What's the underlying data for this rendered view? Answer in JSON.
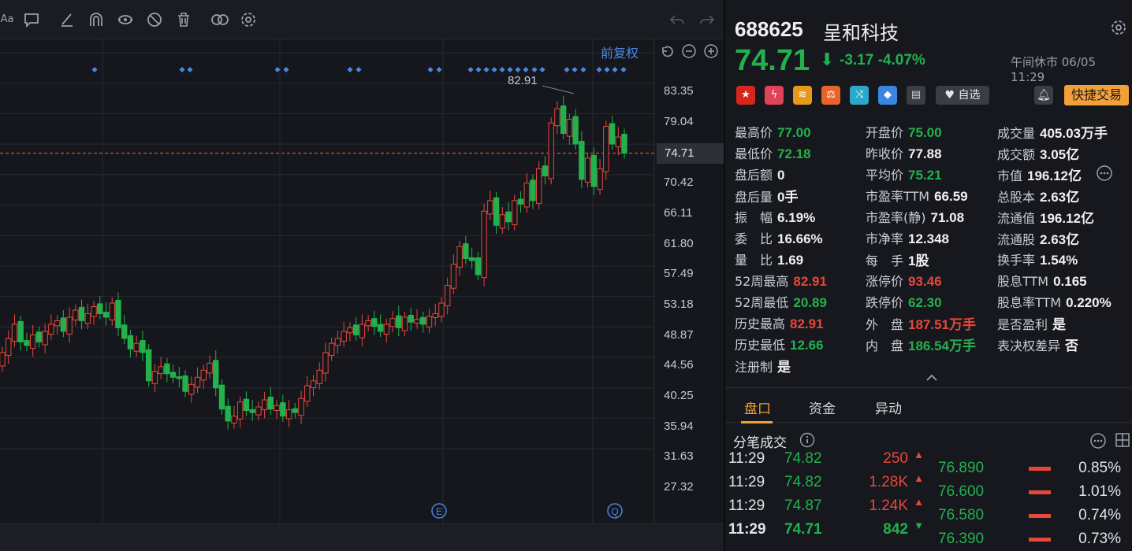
{
  "toolbar": {
    "text_tool": "Aa",
    "icons": [
      "comment-icon",
      "pen-icon",
      "magnet-icon",
      "eye-icon",
      "hide-icon",
      "trash-icon",
      "link-icon",
      "gear-icon",
      "undo-icon",
      "redo-icon"
    ]
  },
  "chart": {
    "adjust_label": "前复权",
    "peak_label": "82.91",
    "axis_ticks": [
      "83.35",
      "79.04",
      "74.71",
      "70.42",
      "66.11",
      "61.80",
      "57.49",
      "53.18",
      "48.87",
      "44.56",
      "40.25",
      "35.94",
      "31.63",
      "27.32"
    ],
    "current_price_tag": "74.71",
    "markers": [
      "E",
      "Q"
    ],
    "colors": {
      "up": "#e8473b",
      "down": "#23b14d",
      "grid": "#262a30",
      "bg": "#15171c",
      "dot": "#4a86e8",
      "price_line": "#e8712f"
    }
  },
  "header": {
    "code": "688625",
    "name": "呈和科技",
    "price": "74.71",
    "change": "-3.17",
    "change_pct": "-4.07%",
    "status": "午间休市 06/05 11:29",
    "watch_label": "自选",
    "trade_label": "快捷交易"
  },
  "stats": [
    {
      "label": "最高价",
      "value": "77.00",
      "color": "green"
    },
    {
      "label": "开盘价",
      "value": "75.00",
      "color": "green"
    },
    {
      "label": "成交量",
      "value": "405.03万手",
      "color": "white"
    },
    {
      "label": "最低价",
      "value": "72.18",
      "color": "green"
    },
    {
      "label": "昨收价",
      "value": "77.88",
      "color": "white"
    },
    {
      "label": "成交额",
      "value": "3.05亿",
      "color": "white"
    },
    {
      "label": "盘后额",
      "value": "0",
      "color": "white"
    },
    {
      "label": "平均价",
      "value": "75.21",
      "color": "green"
    },
    {
      "label": "市值",
      "value": "196.12亿",
      "color": "white"
    },
    {
      "label": "盘后量",
      "value": "0手",
      "color": "white"
    },
    {
      "label": "市盈率TTM",
      "value": "66.59",
      "color": "white"
    },
    {
      "label": "总股本",
      "value": "2.63亿",
      "color": "white"
    },
    {
      "label": "振　幅",
      "value": "6.19%",
      "color": "white"
    },
    {
      "label": "市盈率(静)",
      "value": "71.08",
      "color": "white"
    },
    {
      "label": "流通值",
      "value": "196.12亿",
      "color": "white"
    },
    {
      "label": "委　比",
      "value": "16.66%",
      "color": "white"
    },
    {
      "label": "市净率",
      "value": "12.348",
      "color": "white"
    },
    {
      "label": "流通股",
      "value": "2.63亿",
      "color": "white"
    },
    {
      "label": "量　比",
      "value": "1.69",
      "color": "white"
    },
    {
      "label": "每　手",
      "value": "1股",
      "color": "white"
    },
    {
      "label": "换手率",
      "value": "1.54%",
      "color": "white"
    },
    {
      "label": "52周最高",
      "value": "82.91",
      "color": "red"
    },
    {
      "label": "涨停价",
      "value": "93.46",
      "color": "red"
    },
    {
      "label": "股息TTM",
      "value": "0.165",
      "color": "white"
    },
    {
      "label": "52周最低",
      "value": "20.89",
      "color": "green"
    },
    {
      "label": "跌停价",
      "value": "62.30",
      "color": "green"
    },
    {
      "label": "股息率TTM",
      "value": "0.220%",
      "color": "white"
    },
    {
      "label": "历史最高",
      "value": "82.91",
      "color": "red"
    },
    {
      "label": "外　盘",
      "value": "187.51万手",
      "color": "red"
    },
    {
      "label": "是否盈利",
      "value": "是",
      "color": "white"
    },
    {
      "label": "历史最低",
      "value": "12.66",
      "color": "green"
    },
    {
      "label": "内　盘",
      "value": "186.54万手",
      "color": "green"
    },
    {
      "label": "表决权差异",
      "value": "否",
      "color": "white"
    },
    {
      "label": "注册制",
      "value": "是",
      "color": "white"
    }
  ],
  "tabs": [
    "盘口",
    "资金",
    "异动"
  ],
  "trades": {
    "title": "分笔成交",
    "rows": [
      {
        "time": "11:29",
        "price": "74.82",
        "vol": "250",
        "dir": "up"
      },
      {
        "time": "11:29",
        "price": "74.82",
        "vol": "1.28K",
        "dir": "up"
      },
      {
        "time": "11:29",
        "price": "74.87",
        "vol": "1.24K",
        "dir": "up"
      },
      {
        "time": "11:29",
        "price": "74.71",
        "vol": "842",
        "dir": "down"
      }
    ]
  },
  "book": [
    {
      "price": "76.890",
      "pct": "0.85%"
    },
    {
      "price": "76.600",
      "pct": "1.01%"
    },
    {
      "price": "76.580",
      "pct": "0.74%"
    },
    {
      "price": "76.390",
      "pct": "0.73%"
    }
  ]
}
